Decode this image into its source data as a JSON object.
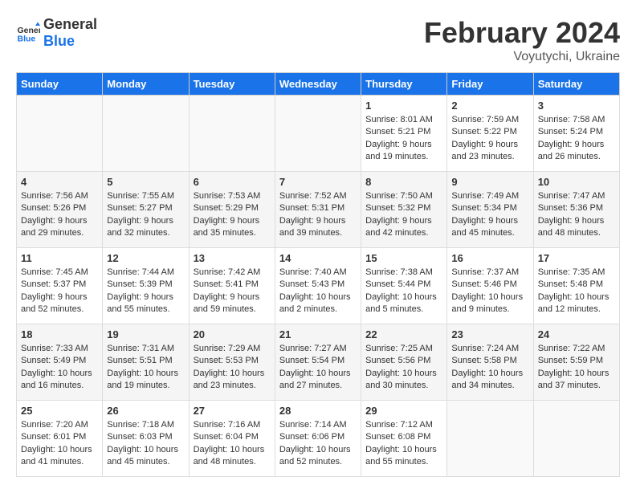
{
  "header": {
    "logo_general": "General",
    "logo_blue": "Blue",
    "month": "February 2024",
    "location": "Voyutychi, Ukraine"
  },
  "days_of_week": [
    "Sunday",
    "Monday",
    "Tuesday",
    "Wednesday",
    "Thursday",
    "Friday",
    "Saturday"
  ],
  "weeks": [
    [
      {
        "day": "",
        "info": ""
      },
      {
        "day": "",
        "info": ""
      },
      {
        "day": "",
        "info": ""
      },
      {
        "day": "",
        "info": ""
      },
      {
        "day": "1",
        "info": "Sunrise: 8:01 AM\nSunset: 5:21 PM\nDaylight: 9 hours\nand 19 minutes."
      },
      {
        "day": "2",
        "info": "Sunrise: 7:59 AM\nSunset: 5:22 PM\nDaylight: 9 hours\nand 23 minutes."
      },
      {
        "day": "3",
        "info": "Sunrise: 7:58 AM\nSunset: 5:24 PM\nDaylight: 9 hours\nand 26 minutes."
      }
    ],
    [
      {
        "day": "4",
        "info": "Sunrise: 7:56 AM\nSunset: 5:26 PM\nDaylight: 9 hours\nand 29 minutes."
      },
      {
        "day": "5",
        "info": "Sunrise: 7:55 AM\nSunset: 5:27 PM\nDaylight: 9 hours\nand 32 minutes."
      },
      {
        "day": "6",
        "info": "Sunrise: 7:53 AM\nSunset: 5:29 PM\nDaylight: 9 hours\nand 35 minutes."
      },
      {
        "day": "7",
        "info": "Sunrise: 7:52 AM\nSunset: 5:31 PM\nDaylight: 9 hours\nand 39 minutes."
      },
      {
        "day": "8",
        "info": "Sunrise: 7:50 AM\nSunset: 5:32 PM\nDaylight: 9 hours\nand 42 minutes."
      },
      {
        "day": "9",
        "info": "Sunrise: 7:49 AM\nSunset: 5:34 PM\nDaylight: 9 hours\nand 45 minutes."
      },
      {
        "day": "10",
        "info": "Sunrise: 7:47 AM\nSunset: 5:36 PM\nDaylight: 9 hours\nand 48 minutes."
      }
    ],
    [
      {
        "day": "11",
        "info": "Sunrise: 7:45 AM\nSunset: 5:37 PM\nDaylight: 9 hours\nand 52 minutes."
      },
      {
        "day": "12",
        "info": "Sunrise: 7:44 AM\nSunset: 5:39 PM\nDaylight: 9 hours\nand 55 minutes."
      },
      {
        "day": "13",
        "info": "Sunrise: 7:42 AM\nSunset: 5:41 PM\nDaylight: 9 hours\nand 59 minutes."
      },
      {
        "day": "14",
        "info": "Sunrise: 7:40 AM\nSunset: 5:43 PM\nDaylight: 10 hours\nand 2 minutes."
      },
      {
        "day": "15",
        "info": "Sunrise: 7:38 AM\nSunset: 5:44 PM\nDaylight: 10 hours\nand 5 minutes."
      },
      {
        "day": "16",
        "info": "Sunrise: 7:37 AM\nSunset: 5:46 PM\nDaylight: 10 hours\nand 9 minutes."
      },
      {
        "day": "17",
        "info": "Sunrise: 7:35 AM\nSunset: 5:48 PM\nDaylight: 10 hours\nand 12 minutes."
      }
    ],
    [
      {
        "day": "18",
        "info": "Sunrise: 7:33 AM\nSunset: 5:49 PM\nDaylight: 10 hours\nand 16 minutes."
      },
      {
        "day": "19",
        "info": "Sunrise: 7:31 AM\nSunset: 5:51 PM\nDaylight: 10 hours\nand 19 minutes."
      },
      {
        "day": "20",
        "info": "Sunrise: 7:29 AM\nSunset: 5:53 PM\nDaylight: 10 hours\nand 23 minutes."
      },
      {
        "day": "21",
        "info": "Sunrise: 7:27 AM\nSunset: 5:54 PM\nDaylight: 10 hours\nand 27 minutes."
      },
      {
        "day": "22",
        "info": "Sunrise: 7:25 AM\nSunset: 5:56 PM\nDaylight: 10 hours\nand 30 minutes."
      },
      {
        "day": "23",
        "info": "Sunrise: 7:24 AM\nSunset: 5:58 PM\nDaylight: 10 hours\nand 34 minutes."
      },
      {
        "day": "24",
        "info": "Sunrise: 7:22 AM\nSunset: 5:59 PM\nDaylight: 10 hours\nand 37 minutes."
      }
    ],
    [
      {
        "day": "25",
        "info": "Sunrise: 7:20 AM\nSunset: 6:01 PM\nDaylight: 10 hours\nand 41 minutes."
      },
      {
        "day": "26",
        "info": "Sunrise: 7:18 AM\nSunset: 6:03 PM\nDaylight: 10 hours\nand 45 minutes."
      },
      {
        "day": "27",
        "info": "Sunrise: 7:16 AM\nSunset: 6:04 PM\nDaylight: 10 hours\nand 48 minutes."
      },
      {
        "day": "28",
        "info": "Sunrise: 7:14 AM\nSunset: 6:06 PM\nDaylight: 10 hours\nand 52 minutes."
      },
      {
        "day": "29",
        "info": "Sunrise: 7:12 AM\nSunset: 6:08 PM\nDaylight: 10 hours\nand 55 minutes."
      },
      {
        "day": "",
        "info": ""
      },
      {
        "day": "",
        "info": ""
      }
    ]
  ]
}
